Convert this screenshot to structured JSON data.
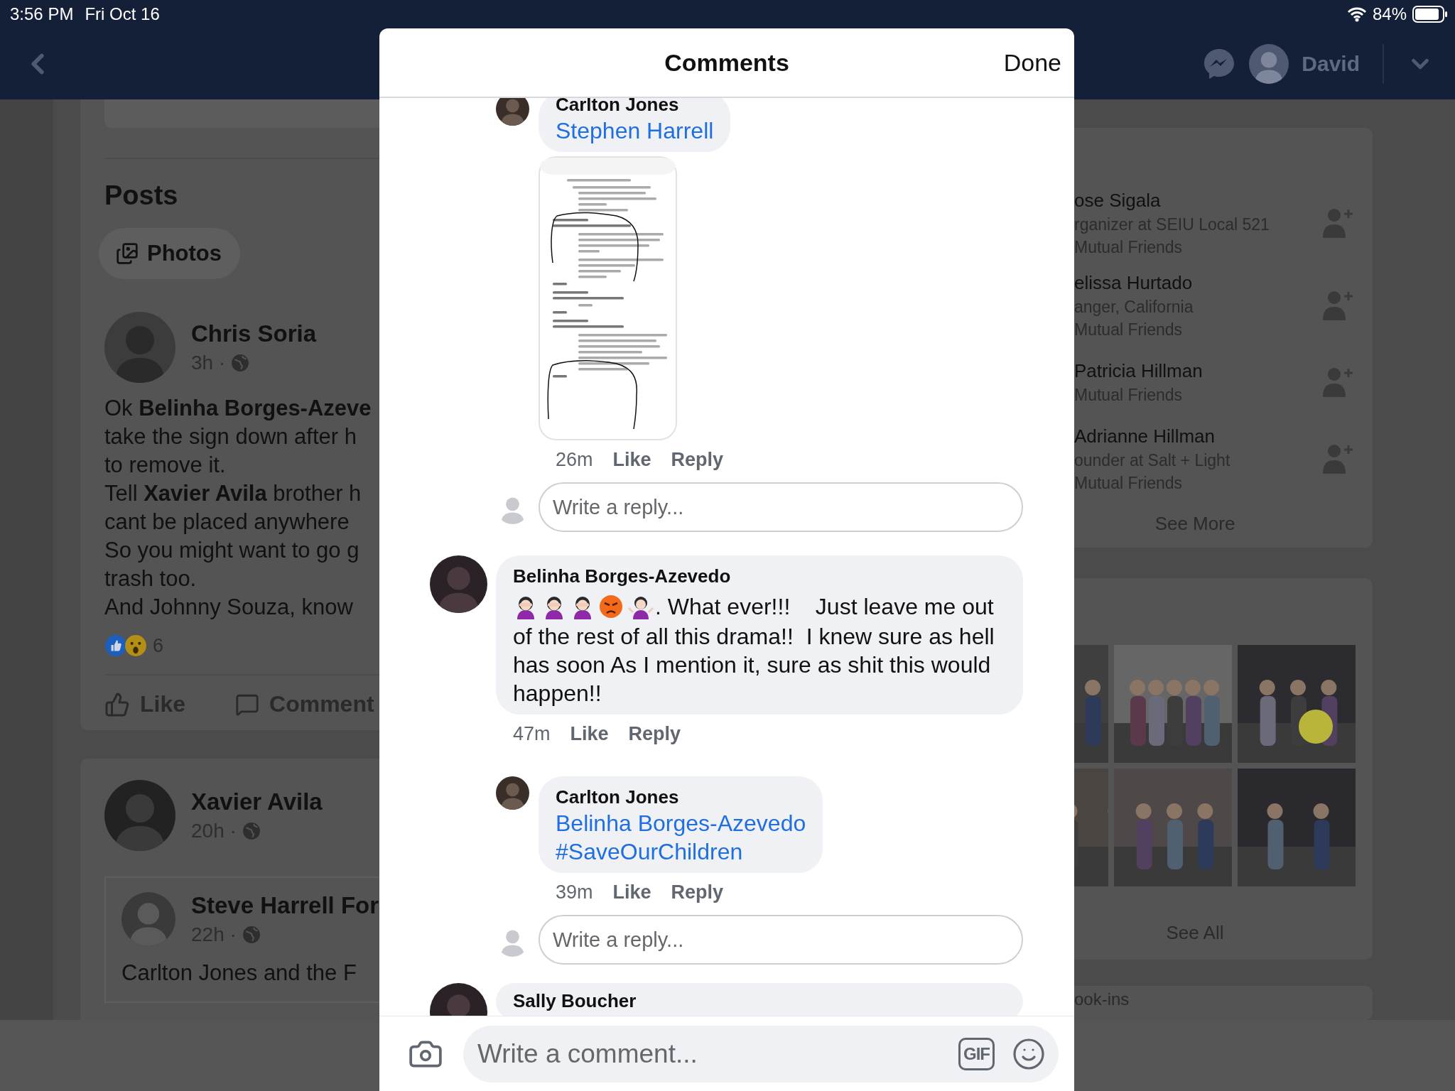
{
  "status_bar": {
    "time": "3:56 PM",
    "date": "Fri Oct 16",
    "battery": "84%"
  },
  "nav": {
    "user": "David"
  },
  "left": {
    "section_title": "Posts",
    "filter": "Photos",
    "posts": [
      {
        "author": "Chris Soria",
        "time": "3h ·",
        "lines": [
          "Ok **Belinha Borges-Azeve**",
          "take the sign down after h",
          "to remove it.",
          "Tell **Xavier Avila** brother h",
          "cant be placed anywhere",
          "So you might want to go g",
          "trash too.",
          "And Johnny Souza, know"
        ],
        "reactions": [
          {
            "kind": "like"
          },
          {
            "kind": "wow"
          }
        ],
        "reaction_count": "6",
        "actions": [
          {
            "kind": "like",
            "label": "Like"
          },
          {
            "kind": "comment",
            "label": "Comment"
          }
        ]
      },
      {
        "author": "Xavier Avila",
        "time": "20h ·",
        "shared": {
          "author": "Steve Harrell For",
          "time": "22h ·",
          "lines": [
            "Carlton Jones and the F"
          ]
        }
      }
    ]
  },
  "right": {
    "people": [
      {
        "name": "ose Sigala",
        "details": [
          "rganizer at SEIU Local 521",
          "Mutual Friends"
        ]
      },
      {
        "name": "elissa Hurtado",
        "details": [
          "anger, California",
          "Mutual Friends"
        ]
      },
      {
        "name": "Patricia Hillman",
        "details": [
          "Mutual Friends"
        ]
      },
      {
        "name": "Adrianne Hillman",
        "details": [
          "ounder at Salt + Light",
          "Mutual Friends"
        ]
      }
    ],
    "see_more": "See More",
    "photos": [
      {
        "kind": "picture"
      },
      {
        "kind": "picture"
      },
      {
        "kind": "picture"
      },
      {
        "kind": "picture"
      },
      {
        "kind": "picture"
      },
      {
        "kind": "picture"
      }
    ],
    "see_all": "See All",
    "next_card_title": "ook-ins"
  },
  "modal": {
    "title": "Comments",
    "done": "Done",
    "items": [
      {
        "kind": "reply",
        "author": "Carlton Jones",
        "links": [
          "Stephen Harrell"
        ],
        "time": "26m",
        "actions": [
          "Like",
          "Reply"
        ],
        "attachment": {
          "kind": "picture"
        }
      },
      {
        "kind": "reply_box",
        "placeholder": "Write a reply..."
      },
      {
        "kind": "comment",
        "author": "Belinha Borges-Azevedo",
        "emojis": [
          {
            "kind": "facepalm"
          },
          {
            "kind": "facepalm"
          },
          {
            "kind": "facepalm"
          },
          {
            "kind": "angry"
          },
          {
            "kind": "shrug"
          }
        ],
        "first_line": ". What ever!!!    Just leave me out",
        "text": "of the rest of all this drama!!  I knew sure as hell has soon As I mention it, sure as shit this would happen!!",
        "time": "47m",
        "actions": [
          "Like",
          "Reply"
        ]
      },
      {
        "kind": "reply",
        "author": "Carlton Jones",
        "links": [
          "Belinha Borges-Azevedo",
          "#SaveOurChildren"
        ],
        "time": "39m",
        "actions": [
          "Like",
          "Reply"
        ]
      },
      {
        "kind": "reply_box",
        "placeholder": "Write a reply..."
      },
      {
        "kind": "comment",
        "author": "Sally Boucher"
      }
    ],
    "composer": {
      "placeholder": "Write a comment...",
      "gif": "GIF"
    }
  }
}
